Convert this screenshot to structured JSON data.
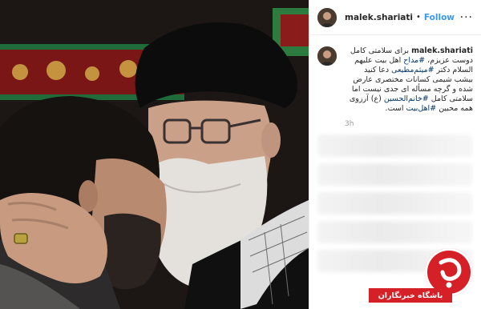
{
  "header": {
    "username": "malek.shariati",
    "separator": "•",
    "follow_label": "Follow",
    "more_label": "···"
  },
  "post": {
    "username": "malek.shariati",
    "caption_part1": "برای سلامتی کامل دوست عزیزم، ",
    "tag1": "#مداح",
    "caption_part2": " اهل بیت علیهم السلام دکتر ",
    "tag2": "#میثم‌مطیعی",
    "caption_part3": " دعا کنید بیشب شیمی کسانات مختصری عارض شده و گرچه مسأله ای جدی نیست اما سلامتی کامل ",
    "tag3": "#خانم‌الحسین",
    "caption_part4": " (ع) آرزوی همه محبین ",
    "tag4": "#اهل‌بیت",
    "caption_part5": " است.",
    "time": "3h"
  },
  "watermark": {
    "label": "باشگاه خبرنگاران"
  },
  "colors": {
    "follow": "#3897f0",
    "hashtag": "#003569",
    "brand_red": "#d52027"
  }
}
